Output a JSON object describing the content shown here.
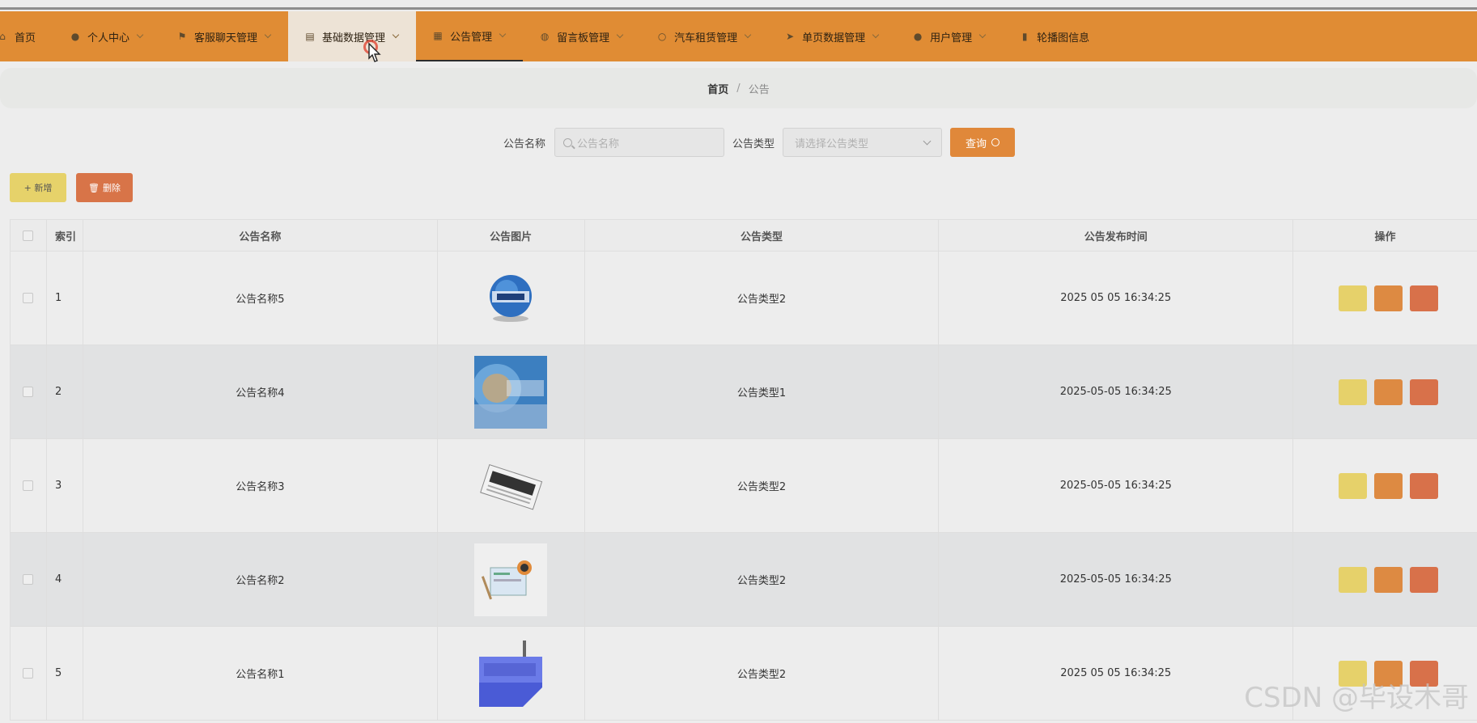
{
  "nav": {
    "items": [
      {
        "label": "首页",
        "icon": "home-icon",
        "glyph": "⌂",
        "chev": false
      },
      {
        "label": "个人中心",
        "icon": "user-icon",
        "glyph": "●",
        "chev": true
      },
      {
        "label": "客服聊天管理",
        "icon": "flag-icon",
        "glyph": "⚑",
        "chev": true
      },
      {
        "label": "基础数据管理",
        "icon": "database-icon",
        "glyph": "▤",
        "chev": true
      },
      {
        "label": "公告管理",
        "icon": "grid-icon",
        "glyph": "▦",
        "chev": true
      },
      {
        "label": "留言板管理",
        "icon": "compass-icon",
        "glyph": "◍",
        "chev": true
      },
      {
        "label": "汽车租赁管理",
        "icon": "circle-icon",
        "glyph": "○",
        "chev": true
      },
      {
        "label": "单页数据管理",
        "icon": "send-icon",
        "glyph": "➤",
        "chev": true
      },
      {
        "label": "用户管理",
        "icon": "person-icon",
        "glyph": "●",
        "chev": true
      },
      {
        "label": "轮播图信息",
        "icon": "bar-chart-icon",
        "glyph": "▮",
        "chev": false
      }
    ]
  },
  "breadcrumb": {
    "home": "首页",
    "sep": "/",
    "current": "公告"
  },
  "search": {
    "name_label": "公告名称",
    "name_placeholder": "公告名称",
    "type_label": "公告类型",
    "type_placeholder": "请选择公告类型",
    "query_label": "查询"
  },
  "actions": {
    "add_label": "+ 新增",
    "delete_label": "删除"
  },
  "table": {
    "headers": [
      "索引",
      "公告名称",
      "公告图片",
      "公告类型",
      "公告发布时间",
      "操作"
    ],
    "rows": [
      {
        "index": "1",
        "name": "公告名称5",
        "type": "公告类型2",
        "time": "2025 05 05 16:34:25",
        "image": "globe-news-image"
      },
      {
        "index": "2",
        "name": "公告名称4",
        "type": "公告类型1",
        "time": "2025-05-05 16:34:25",
        "image": "blue-news-image"
      },
      {
        "index": "3",
        "name": "公告名称3",
        "type": "公告类型2",
        "time": "2025-05-05 16:34:25",
        "image": "newspaper-image"
      },
      {
        "index": "4",
        "name": "公告名称2",
        "type": "公告类型2",
        "time": "2025-05-05 16:34:25",
        "image": "news-illustration-image"
      },
      {
        "index": "5",
        "name": "公告名称1",
        "type": "公告类型2",
        "time": "2025 05 05 16:34:25",
        "image": "news-key-image"
      }
    ]
  },
  "watermark": "CSDN @毕设木哥"
}
